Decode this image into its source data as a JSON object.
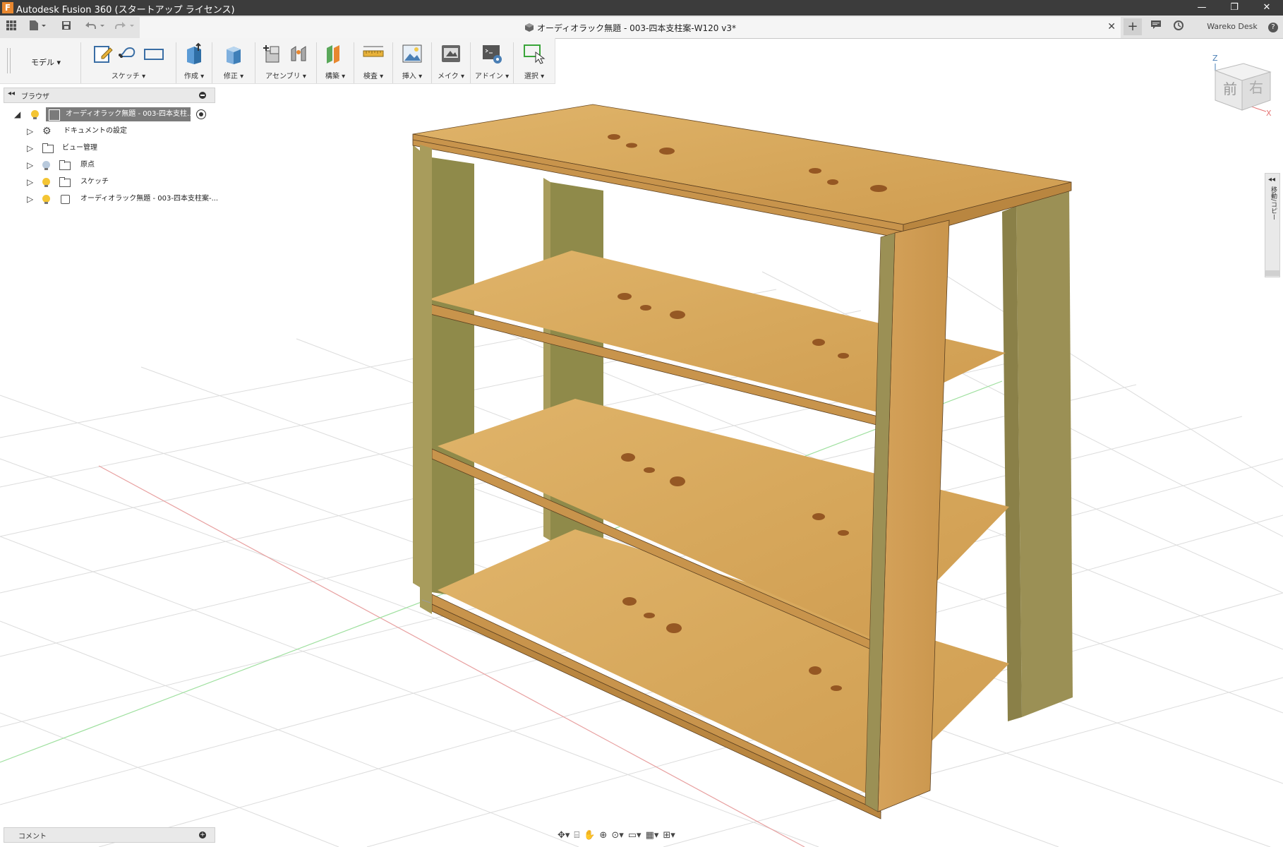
{
  "window": {
    "title": "Autodesk Fusion 360 (スタートアップ ライセンス)",
    "app_icon": "F",
    "minimize_glyph": "—",
    "restore_glyph": "❐",
    "close_glyph": "✕"
  },
  "quick_access": {
    "grid_icon": "grid-icon",
    "file_icon": "file-icon",
    "save_icon": "save-icon",
    "undo_icon": "undo-icon",
    "redo_icon": "redo-icon"
  },
  "document_tab": {
    "title": "オーディオラック無題 - 003-四本支柱案-W120 v3*",
    "close": "✕"
  },
  "right_tools": {
    "new_tab": "+",
    "user_name": "Wareko Desk",
    "help": "?"
  },
  "ribbon": {
    "workspace": "モデル ▾",
    "groups": [
      {
        "label": "スケッチ ▾"
      },
      {
        "label": "作成 ▾"
      },
      {
        "label": "修正 ▾"
      },
      {
        "label": "アセンブリ ▾"
      },
      {
        "label": "構築 ▾"
      },
      {
        "label": "検査 ▾"
      },
      {
        "label": "挿入 ▾"
      },
      {
        "label": "メイク ▾"
      },
      {
        "label": "アドイン ▾"
      },
      {
        "label": "選択 ▾"
      }
    ]
  },
  "browser": {
    "header_label": "ブラウザ",
    "collapse": "◂◂",
    "root": "オーディオラック無題 - 003-四本支柱...",
    "items": [
      {
        "label": "ドキュメントの設定",
        "icon": "gear-icon"
      },
      {
        "label": "ビュー管理",
        "icon": "folder-icon"
      },
      {
        "label": "原点",
        "icon": "folder-icon"
      },
      {
        "label": "スケッチ",
        "icon": "folder-icon"
      },
      {
        "label": "オーディオラック無題 - 003-四本支柱案-...",
        "icon": "body-icon"
      }
    ]
  },
  "viewcube": {
    "front": "前",
    "right": "右",
    "axis_z": "Z",
    "axis_x": "X"
  },
  "right_panel": {
    "label": "移動/コピー",
    "arrows": "◂◂"
  },
  "comments": {
    "label": "コメント",
    "plus": "+"
  },
  "colors": {
    "wood": "#d9a95e",
    "wood_dark": "#b88a45",
    "edge_olive": "#9a8a52",
    "grid": "#dcdcdc",
    "axis_red": "#e57373",
    "axis_green": "#7fd27f",
    "accent": "#e8872f"
  }
}
